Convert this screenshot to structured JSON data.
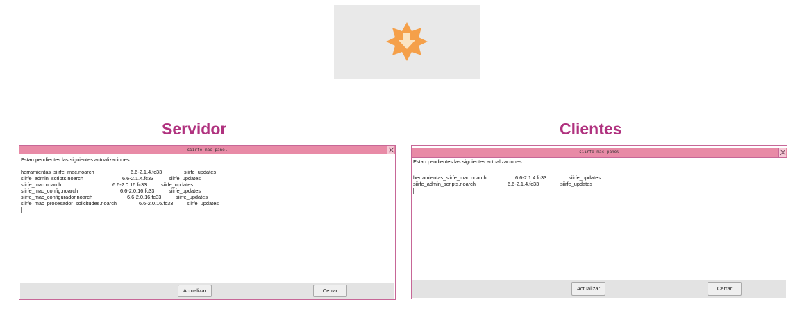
{
  "top_icon": {
    "icon": "update-star-icon",
    "colors": {
      "star": "#f5a04a",
      "arrow": "#fbe4c2"
    }
  },
  "colors": {
    "title": "#b0327f",
    "titlebar": "#e88aa6",
    "border": "#c76797",
    "footer": "#e3e3e3"
  },
  "panels": [
    {
      "heading": "Servidor",
      "window_title": "siirfe_mac_panel",
      "message": "Estan pendientes las siguientes actualizaciones:",
      "rows": [
        {
          "package": "herramientas_siirfe_mac.noarch",
          "version": "6.6-2.1.4.fc33",
          "repo": "siirfe_updates"
        },
        {
          "package": "siirfe_admin_scripts.noarch",
          "version": "6.6-2.1.4.fc33",
          "repo": "siirfe_updates"
        },
        {
          "package": "siirfe_mac.noarch",
          "version": "6.6-2.0.16.fc33",
          "repo": "siirfe_updates"
        },
        {
          "package": "siirfe_mac_config.noarch",
          "version": "6.6-2.0.16.fc33",
          "repo": "siirfe_updates"
        },
        {
          "package": "siirfe_mac_configurador.noarch",
          "version": "6.6-2.0.16.fc33",
          "repo": "siirfe_updates"
        },
        {
          "package": "siirfe_mac_procesador_solicitudes.noarch",
          "version": "6.6-2.0.16.fc33",
          "repo": "siirfe_updates"
        }
      ],
      "update_button": "Actualizar",
      "close_button": "Cerrar"
    },
    {
      "heading": "Clientes",
      "window_title": "siirfe_mac_panel",
      "message": "Estan pendientes las siguientes actualizaciones:",
      "rows": [
        {
          "package": "herramientas_siirfe_mac.noarch",
          "version": "6.6-2.1.4.fc33",
          "repo": "siirfe_updates"
        },
        {
          "package": "siirfe_admin_scripts.noarch",
          "version": "6.6-2.1.4.fc33",
          "repo": "siirfe_updates"
        }
      ],
      "update_button": "Actualizar",
      "close_button": "Cerrar"
    }
  ]
}
